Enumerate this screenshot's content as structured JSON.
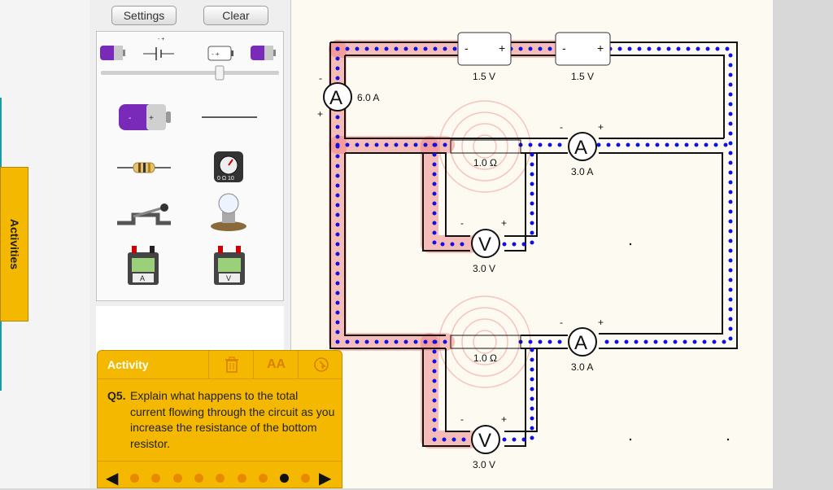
{
  "side_tab": {
    "label": "Activities"
  },
  "toolbox": {
    "settings_label": "Settings",
    "clear_label": "Clear"
  },
  "activity": {
    "header_title": "Activity",
    "trash_icon": "trash-icon",
    "text_size_label": "AA",
    "hint_icon": "pointer-icon",
    "question_number": "Q5.",
    "question_text": "Explain what happens to the total current flowing through the circuit as you increase the resistance of the bottom resistor.",
    "pages_total": 9,
    "current_page": 8
  },
  "circuit": {
    "battery1": {
      "label": "1.5 V",
      "neg": "-",
      "pos": "+"
    },
    "battery2": {
      "label": "1.5 V",
      "neg": "-",
      "pos": "+"
    },
    "ammeter_main": {
      "symbol": "A",
      "reading": "6.0 A",
      "neg": "-",
      "pos": "+"
    },
    "ammeter_top": {
      "symbol": "A",
      "reading": "3.0 A",
      "neg": "-",
      "pos": "+"
    },
    "ammeter_bottom": {
      "symbol": "A",
      "reading": "3.0 A",
      "neg": "-",
      "pos": "+"
    },
    "resistor_top": {
      "label": "1.0 Ω"
    },
    "resistor_bottom": {
      "label": "1.0 Ω"
    },
    "voltmeter_top": {
      "symbol": "V",
      "reading": "3.0 V",
      "neg": "-",
      "pos": "+"
    },
    "voltmeter_bottom": {
      "symbol": "V",
      "reading": "3.0 V",
      "neg": "-",
      "pos": "+"
    }
  },
  "colors": {
    "activity_bg": "#f5b800",
    "current_dots": "#1010e0",
    "voltage_glow": "#f08080",
    "wire": "#111111"
  }
}
